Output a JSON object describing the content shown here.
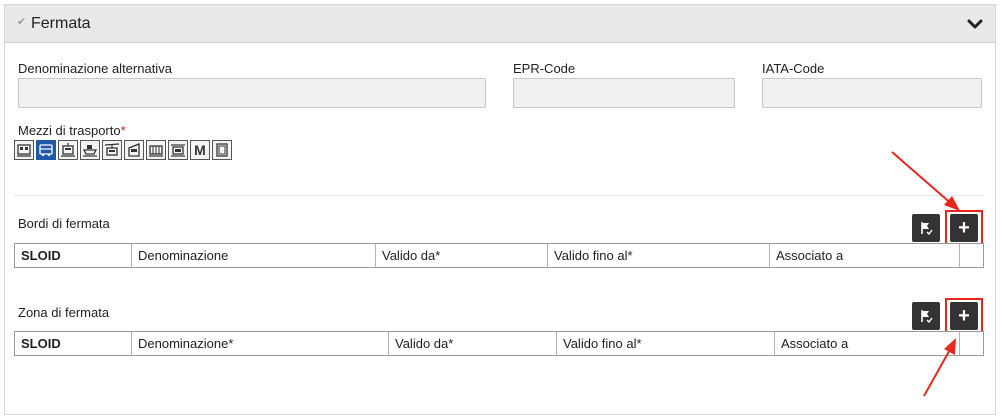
{
  "panel": {
    "title": "Fermata",
    "check_glyph": "✔",
    "expand_icon": "chevron-down-icon"
  },
  "fields": {
    "alt_name_label": "Denominazione alternativa",
    "alt_name_value": "",
    "epr_label": "EPR-Code",
    "epr_value": "",
    "iata_label": "IATA-Code",
    "iata_value": ""
  },
  "transport": {
    "label": "Mezzi di trasporto",
    "required_mark": "*",
    "modes": [
      {
        "icon": "train-icon",
        "active": false
      },
      {
        "icon": "bus-icon",
        "active": true
      },
      {
        "icon": "tram-icon",
        "active": false
      },
      {
        "icon": "ship-icon",
        "active": false
      },
      {
        "icon": "cable-car-icon",
        "active": false
      },
      {
        "icon": "rack-railway-icon",
        "active": false
      },
      {
        "icon": "funicular-icon",
        "active": false
      },
      {
        "icon": "chairlift-icon",
        "active": false
      },
      {
        "icon": "metro-icon",
        "active": false
      },
      {
        "icon": "elevator-icon",
        "active": false
      }
    ],
    "metro_glyph": "M"
  },
  "bordi": {
    "title": "Bordi di fermata",
    "columns": [
      "SLOID",
      "Denominazione",
      "Valido da*",
      "Valido fino al*",
      "Associato a",
      ""
    ],
    "add_glyph": "+",
    "action_icon": "flag-edit-icon"
  },
  "zona": {
    "title": "Zona di fermata",
    "columns": [
      "SLOID",
      "Denominazione*",
      "Valido da*",
      "Valido fino al*",
      "Associato a",
      ""
    ],
    "add_glyph": "+",
    "action_icon": "flag-edit-icon"
  },
  "colors": {
    "header_bg": "#e9e9e9",
    "active_mode": "#1f59a8",
    "button_bg": "#333333",
    "highlight": "#e8271f",
    "required": "#d21f1f"
  }
}
